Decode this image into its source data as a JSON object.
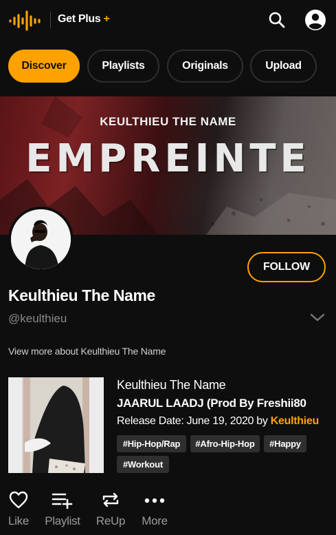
{
  "header": {
    "brand": "Get Plus",
    "brand_plus": "+",
    "accent_color": "#ffa200",
    "logo_icon": "audiomack-waveform-logo",
    "search_icon": "search-icon",
    "account_icon": "user-circle-icon"
  },
  "tabs": [
    {
      "label": "Discover",
      "active": true
    },
    {
      "label": "Playlists",
      "active": false
    },
    {
      "label": "Originals",
      "active": false
    },
    {
      "label": "Upload",
      "active": false
    }
  ],
  "banner": {
    "artist": "KEULTHIEU THE NAME",
    "title": "EMPREINTE"
  },
  "profile": {
    "follow_label": "FOLLOW",
    "name": "Keulthieu The Name",
    "handle": "@keulthieu",
    "view_more": "View more about Keulthieu The Name"
  },
  "track": {
    "artist": "Keulthieu The Name",
    "title": "JAARUL LAADJ (Prod By Freshii80",
    "release_prefix": "Release Date: June 19, 2020 by ",
    "release_by": "Keulthieu",
    "tags": [
      "#Hip-Hop/Rap",
      "#Afro-Hip-Hop",
      "#Happy",
      "#Workout"
    ]
  },
  "actions": [
    {
      "label": "Like",
      "icon": "heart-icon"
    },
    {
      "label": "Playlist",
      "icon": "add-to-playlist-icon"
    },
    {
      "label": "ReUp",
      "icon": "repost-icon"
    },
    {
      "label": "More",
      "icon": "more-dots-icon"
    }
  ]
}
